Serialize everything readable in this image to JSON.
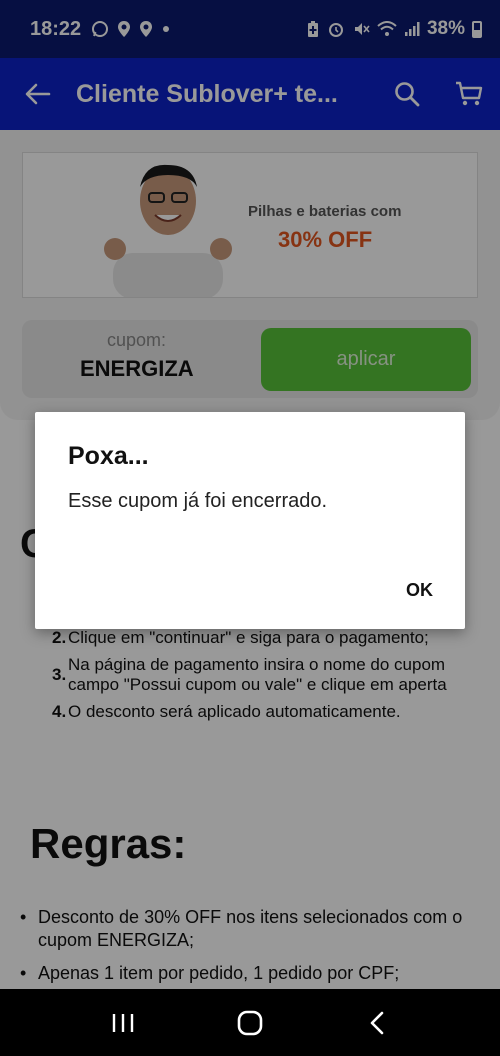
{
  "status_bar": {
    "time": "18:22",
    "battery_percent": "38%",
    "left_icons": [
      "whatsapp-icon",
      "location-icon",
      "location-icon",
      "dot-icon"
    ],
    "right_icons": [
      "battery-saver-icon",
      "alarm-icon",
      "mute-icon",
      "wifi-icon",
      "signal-icon"
    ]
  },
  "app_bar": {
    "title": "Cliente Sublover+ te...",
    "back_icon": "back-arrow-icon",
    "search_icon": "search-icon",
    "cart_icon": "cart-icon"
  },
  "banner": {
    "promo_line": "Pilhas e baterias com",
    "promo_highlight": "30% OFF"
  },
  "coupon": {
    "label": "cupom:",
    "code": "ENERGIZA",
    "apply_label": "aplicar"
  },
  "steps": {
    "heading_start": "C",
    "heading_end": ":",
    "items": [
      {
        "num": "2.",
        "text": "Clique em \"continuar\" e siga para o pagamento;"
      },
      {
        "num": "3.",
        "text": "Na página de pagamento insira o nome do cupom",
        "text2": "campo \"Possui cupom ou vale\"  e clique em aperta"
      },
      {
        "num": "4.",
        "text": "O desconto será aplicado automaticamente."
      }
    ]
  },
  "rules": {
    "title": "Regras:",
    "items": [
      "Desconto de 30% OFF nos itens selecionados com o cupom ENERGIZA;",
      "Apenas 1 item por pedido, 1 pedido por CPF;"
    ]
  },
  "dialog": {
    "title": "Poxa...",
    "message": "Esse cupom já foi encerrado.",
    "ok_label": "OK"
  },
  "colors": {
    "status_bar": "#0a1a6e",
    "app_bar": "#0d22c8",
    "apply_button": "#58c23a",
    "promo_accent": "#e2561f"
  }
}
